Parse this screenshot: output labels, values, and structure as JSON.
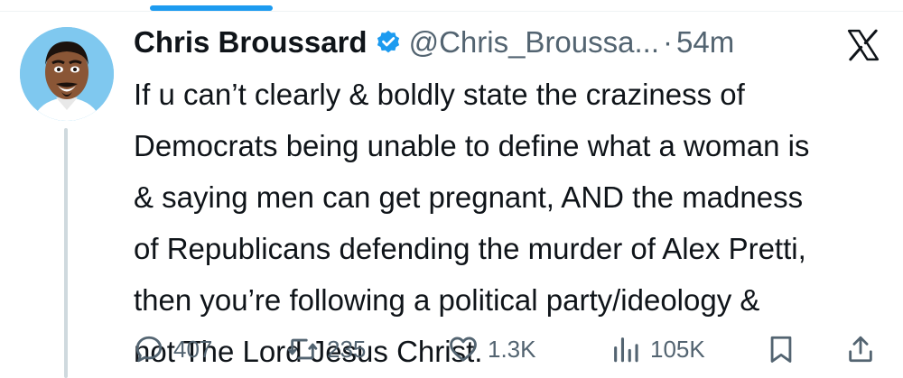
{
  "author": {
    "display_name": "Chris Broussard",
    "handle": "@Chris_Broussa...",
    "separator": "·",
    "time": "54m",
    "verified": true
  },
  "tweet": {
    "text": "If u can’t clearly & boldly state the craziness of\nDemocrats being unable to define what a woman is\n& saying men can get pregnant, AND the madness\nof Republicans defending the murder of Alex Pretti,\nthen you’re following a political party/ideology &\nnot The Lord Jesus Christ."
  },
  "actions": {
    "replies": "407",
    "reposts": "235",
    "likes": "1.3K",
    "views": "105K"
  },
  "icons": {
    "logo": "x-logo-icon",
    "verified": "verified-badge-icon",
    "reply": "reply-icon",
    "repost": "repost-icon",
    "like": "heart-icon",
    "views": "views-chart-icon",
    "bookmark": "bookmark-icon",
    "share": "share-icon"
  },
  "colors": {
    "accent": "#1d9bf0",
    "text": "#0f1419",
    "secondary": "#536471",
    "avatar_bg": "#7fc8ef"
  }
}
